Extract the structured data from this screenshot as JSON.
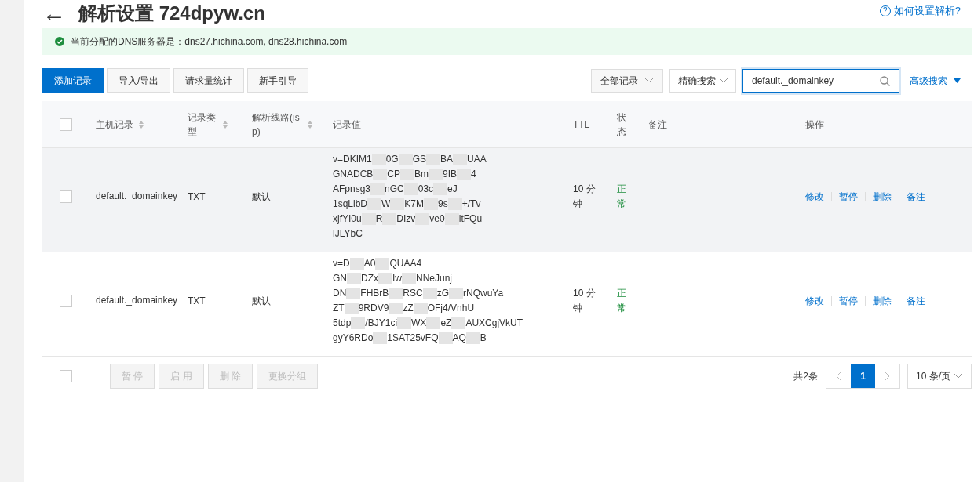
{
  "header": {
    "back": "←",
    "title": "解析设置 724dpyw.cn",
    "help_icon": "?",
    "help_link": "如何设置解析?"
  },
  "notice": {
    "text": "当前分配的DNS服务器是：dns27.hichina.com, dns28.hichina.com"
  },
  "toolbar": {
    "buttons": [
      {
        "label": "添加记录",
        "primary": true
      },
      {
        "label": "导入/导出",
        "primary": false
      },
      {
        "label": "请求量统计",
        "primary": false
      },
      {
        "label": "新手引导",
        "primary": false
      }
    ],
    "filter": "全部记录",
    "match_mode": "精确搜索",
    "search_value": "default._domainkey",
    "advanced": "高级搜索"
  },
  "table": {
    "columns": [
      {
        "label": "主机记录",
        "sortable": true
      },
      {
        "label": "记录类型",
        "sortable": true
      },
      {
        "label": "解析线路(isp)",
        "sortable": true
      },
      {
        "label": "记录值",
        "sortable": false
      },
      {
        "label": "TTL",
        "sortable": false
      },
      {
        "label": "状态",
        "sortable": false
      },
      {
        "label": "备注",
        "sortable": false
      },
      {
        "label": "操作",
        "sortable": false
      }
    ],
    "rows": [
      {
        "checked": false,
        "highlighted": true,
        "host": "default._domainkey",
        "type": "TXT",
        "line": "默认",
        "value_lines": [
          [
            "v=DKIM1",
            "0G",
            "GS",
            "BA",
            "UAA"
          ],
          [
            "GNADCB",
            "CP",
            "Bm",
            "9IB",
            "4"
          ],
          [
            "AFpnsg3",
            "nGC",
            "03c",
            "eJ"
          ],
          [
            "1sqLibD",
            "W",
            "K7M",
            "9s",
            "+/Tv"
          ],
          [
            "xjfYI0u",
            "R",
            "DIzv",
            "ve0",
            "ltFQu"
          ],
          [
            "lJLYbC"
          ]
        ],
        "ttl": "10 分钟",
        "status": "正常",
        "actions": [
          "修改",
          "暂停",
          "删除",
          "备注"
        ]
      },
      {
        "checked": false,
        "highlighted": false,
        "host": "default._domainkey",
        "type": "TXT",
        "line": "默认",
        "value_lines": [
          [
            "v=D",
            "A0",
            "QUAA4"
          ],
          [
            "GN",
            "DZx",
            "Iw",
            "NNeJunj"
          ],
          [
            "DN",
            "FHBrB",
            "RSC",
            "zG",
            "rNQwuYa"
          ],
          [
            "ZT",
            "9RDV9",
            "zZ",
            "OFj4/VnhU"
          ],
          [
            "5tdp",
            "/BJY1ci",
            "WX",
            "eZ",
            "AUXCgjVkUT"
          ],
          [
            "gyY6RDo",
            "1SAT25vFQ",
            "AQ",
            "B"
          ]
        ],
        "ttl": "10 分钟",
        "status": "正常",
        "actions": [
          "修改",
          "暂停",
          "删除",
          "备注"
        ]
      }
    ]
  },
  "footer": {
    "all_checked": false,
    "bulk_buttons": [
      {
        "label": "暂 停",
        "disabled": true
      },
      {
        "label": "启 用",
        "disabled": true
      },
      {
        "label": "删 除",
        "disabled": true
      },
      {
        "label": "更换分组",
        "disabled": true
      }
    ],
    "total": "共2条",
    "pages": [
      {
        "label": "1",
        "selected": true
      }
    ],
    "page_size": "10 条/页"
  }
}
